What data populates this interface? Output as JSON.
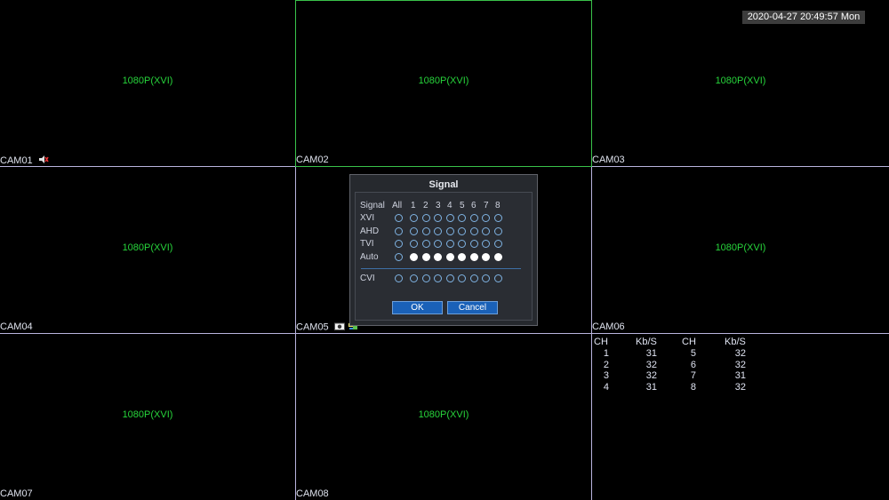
{
  "datetime": "2020-04-27 20:49:57 Mon",
  "resolution_label": "1080P(XVI)",
  "cameras": [
    {
      "name": "CAM01"
    },
    {
      "name": "CAM02"
    },
    {
      "name": "CAM03"
    },
    {
      "name": "CAM04"
    },
    {
      "name": "CAM05"
    },
    {
      "name": "CAM06"
    },
    {
      "name": "CAM07"
    },
    {
      "name": "CAM08"
    }
  ],
  "bitrate": {
    "headers": [
      "CH",
      "Kb/S",
      "CH",
      "Kb/S"
    ],
    "rows": [
      [
        "1",
        "31",
        "5",
        "32"
      ],
      [
        "2",
        "32",
        "6",
        "32"
      ],
      [
        "3",
        "32",
        "7",
        "31"
      ],
      [
        "4",
        "31",
        "8",
        "32"
      ]
    ]
  },
  "signal_dialog": {
    "title": "Signal",
    "header_label": "Signal",
    "columns": [
      "All",
      "1",
      "2",
      "3",
      "4",
      "5",
      "6",
      "7",
      "8"
    ],
    "rows": [
      {
        "label": "XVI",
        "selected": [
          false,
          false,
          false,
          false,
          false,
          false,
          false,
          false,
          false
        ]
      },
      {
        "label": "AHD",
        "selected": [
          false,
          false,
          false,
          false,
          false,
          false,
          false,
          false,
          false
        ]
      },
      {
        "label": "TVI",
        "selected": [
          false,
          false,
          false,
          false,
          false,
          false,
          false,
          false,
          false
        ]
      },
      {
        "label": "Auto",
        "selected": [
          false,
          true,
          true,
          true,
          true,
          true,
          true,
          true,
          true
        ]
      },
      {
        "label": "CVI",
        "selected": [
          false,
          false,
          false,
          false,
          false,
          false,
          false,
          false,
          false
        ]
      }
    ],
    "ok_label": "OK",
    "cancel_label": "Cancel"
  },
  "colors": {
    "grid": "#b9b4de",
    "resolution_text": "#27d43b",
    "button": "#1a61b8",
    "radio": "#7fb3e3"
  }
}
